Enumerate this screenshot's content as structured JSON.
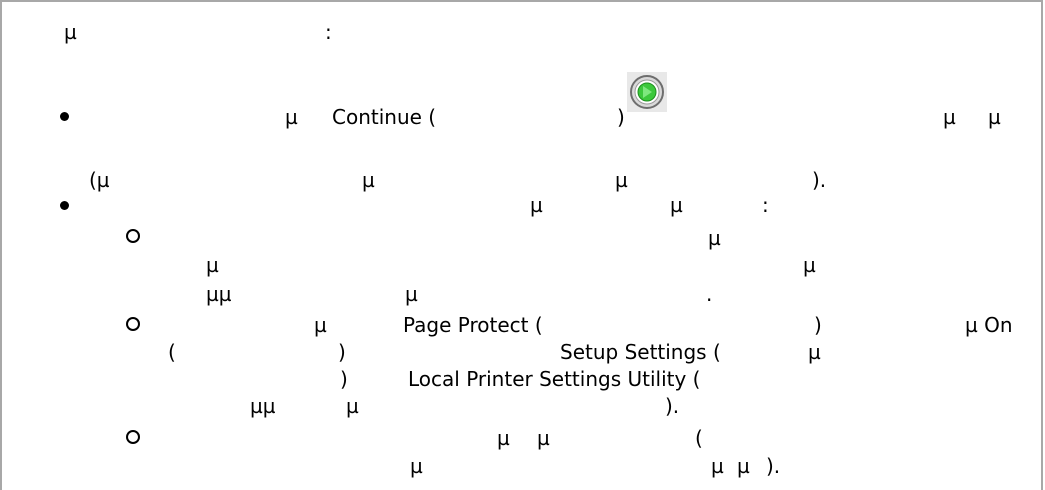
{
  "intro": {
    "glyph": "µ",
    "colon": ":"
  },
  "bullet1": {
    "glyph1": "µ",
    "continue_phrase": "Continue (",
    "close_paren": ")",
    "glyph2": "µ",
    "glyph3": "µ",
    "line2_open": "(µ",
    "line2_g1": "µ",
    "line2_g2": "µ",
    "line2_close": ")."
  },
  "continue_button": {
    "icon": "continue-icon",
    "ring_color": "#8a8a8a",
    "fill_color": "#3cc83c"
  },
  "bullet2": {
    "g1": "µ",
    "g2": "µ",
    "colon": ":"
  },
  "sub1": {
    "line1_g": "µ",
    "line2_g1": "µ",
    "line2_g2": "µ",
    "line3_g1": "µµ",
    "line3_g2": "µ",
    "line3_end": "."
  },
  "sub2": {
    "g1": "µ",
    "page_protect": "Page Protect (",
    "paren_close": ")",
    "on_text": "µ On",
    "line2_open": "(",
    "line2_close": ")",
    "setup_settings": "Setup Settings (",
    "line2_g": "µ",
    "line3_close": ")",
    "local_utility": "Local Printer Settings Utility (",
    "line4_g1": "µµ",
    "line4_g2": "µ",
    "line4_end": ")."
  },
  "sub3": {
    "g1": "µ",
    "g2": "µ",
    "open": "(",
    "line2_g1": "µ",
    "line2_g2": "µ",
    "line2_g3": "µ",
    "line2_end": ")."
  }
}
